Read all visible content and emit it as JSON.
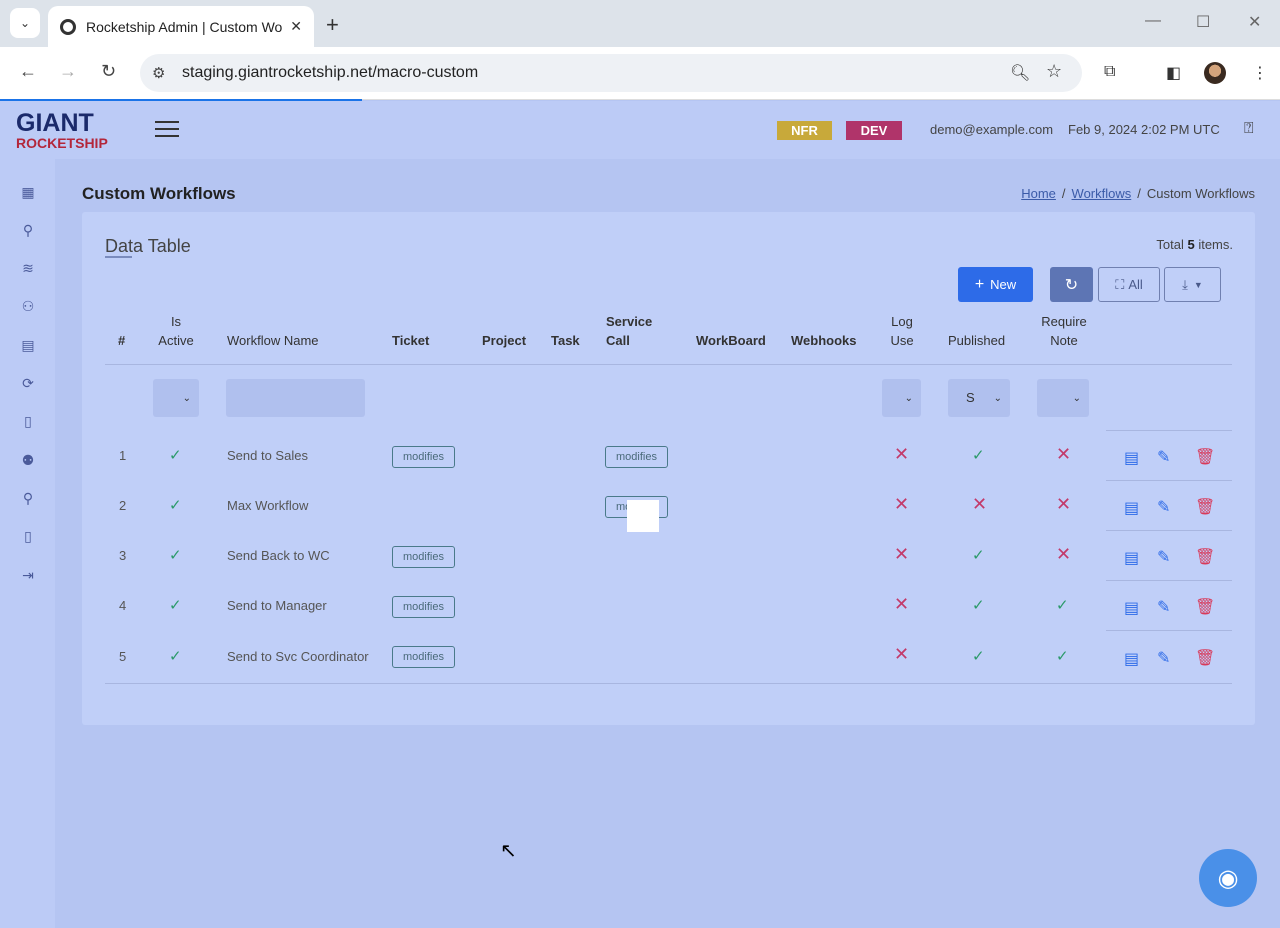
{
  "browser": {
    "tab_title": "Rocketship Admin | Custom Wo",
    "url": "staging.giantrocketship.net/macro-custom"
  },
  "header": {
    "logo_line1": "GIANT",
    "logo_line2": "ROCKETSHIP",
    "badge_nfr": "NFR",
    "badge_dev": "DEV",
    "user": "demo@example.com",
    "datetime": "Feb 9, 2024 2:02 PM UTC",
    "colors": {
      "nfr": "#c8a93a",
      "dev": "#b0346a"
    }
  },
  "sidebar": {
    "icons": [
      "grid-icon",
      "search-icon",
      "layers-icon",
      "users-network-icon",
      "calendar-icon",
      "refresh-icon",
      "document-icon",
      "group-icon",
      "user-icon",
      "report-icon",
      "logout-icon"
    ]
  },
  "page": {
    "title": "Custom Workflows",
    "breadcrumb": {
      "home": "Home",
      "workflows": "Workflows",
      "current": "Custom Workflows"
    }
  },
  "card": {
    "title": "Data Table",
    "total_prefix": "Total ",
    "total_count": "5",
    "total_suffix": " items.",
    "new_label": "New",
    "all_label": "All"
  },
  "table": {
    "headers": {
      "num": "#",
      "is_active_1": "Is",
      "is_active_2": "Active",
      "name": "Workflow Name",
      "ticket": "Ticket",
      "project": "Project",
      "task": "Task",
      "service_call_1": "Service",
      "service_call_2": "Call",
      "workboard": "WorkBoard",
      "webhooks": "Webhooks",
      "log_use_1": "Log",
      "log_use_2": "Use",
      "published": "Published",
      "require_note_1": "Require",
      "require_note_2": "Note"
    },
    "filters": {
      "published": "S"
    },
    "tag_label": "modifies",
    "rows": [
      {
        "num": "1",
        "name": "Send to Sales"
      },
      {
        "num": "2",
        "name": "Max Workflow"
      },
      {
        "num": "3",
        "name": "Send Back to WC"
      },
      {
        "num": "4",
        "name": "Send to Manager"
      },
      {
        "num": "5",
        "name": "Send to Svc Coordinator"
      }
    ]
  }
}
